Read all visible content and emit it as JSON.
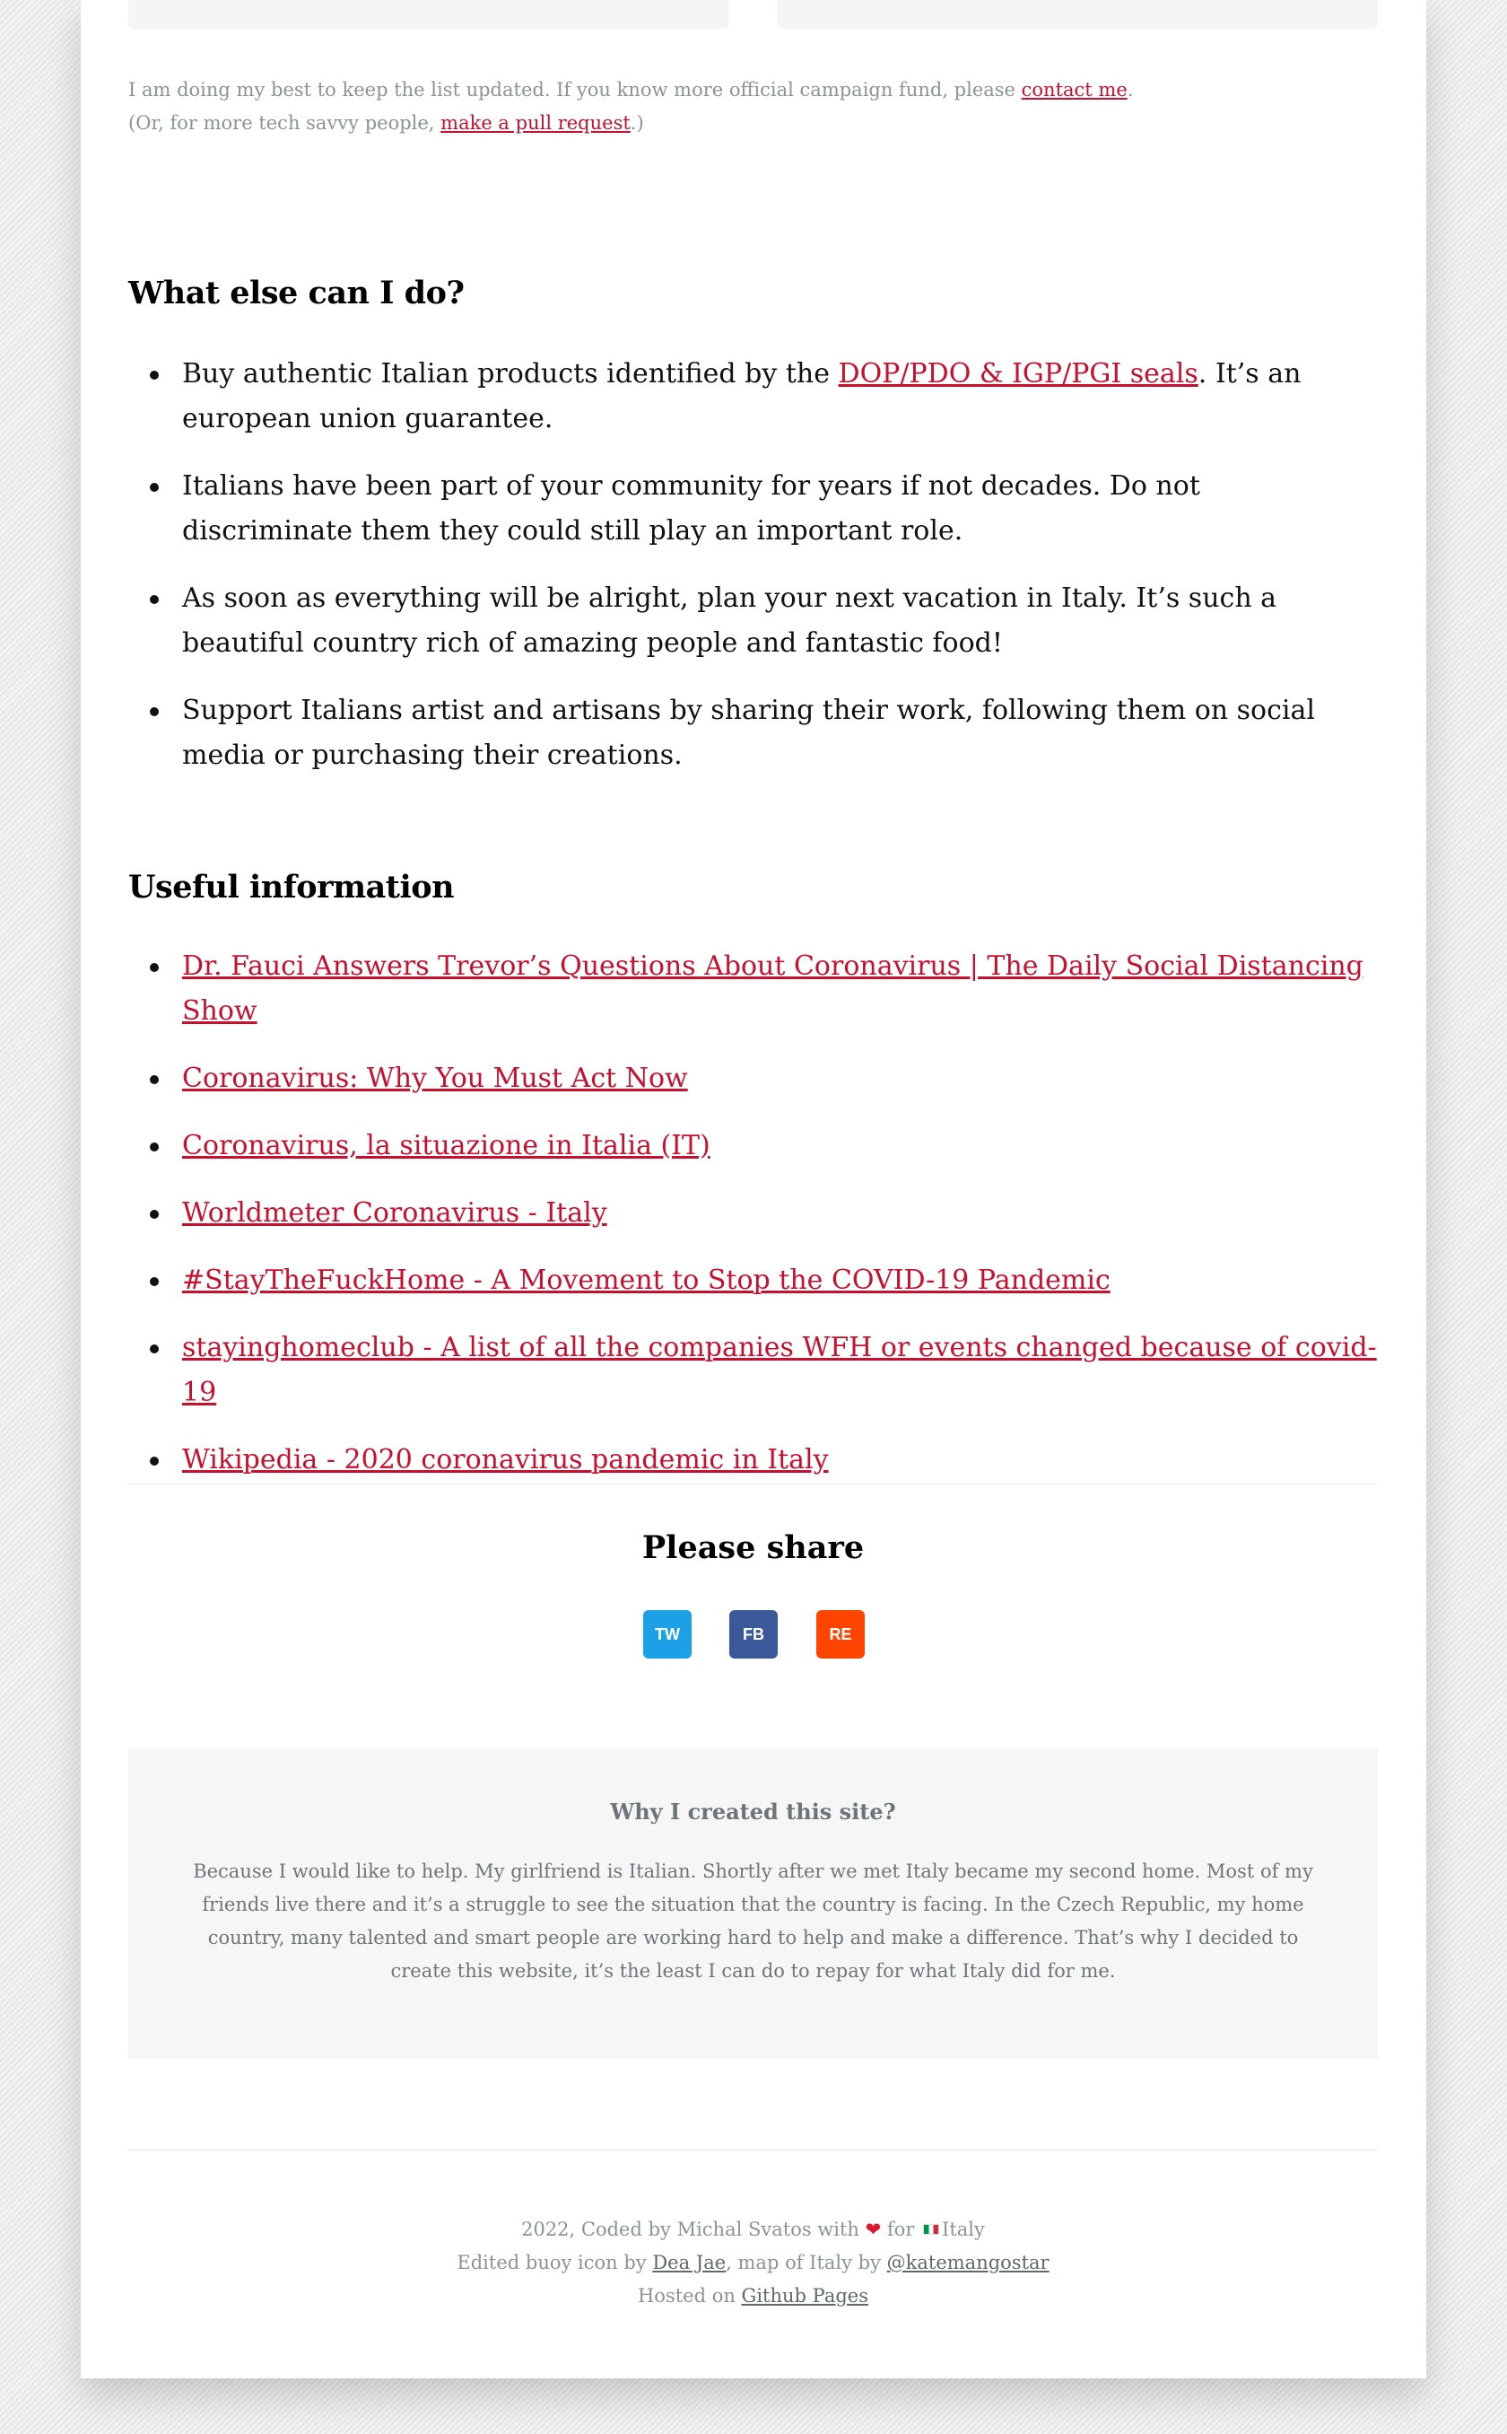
{
  "note": {
    "line1_prefix": "I am doing my best to keep the list updated. If you know more official campaign fund, please ",
    "line1_link": "contact me",
    "line1_suffix": ".",
    "line2_prefix": "(Or, for more tech savvy people, ",
    "line2_link": "make a pull request",
    "line2_suffix": ".)"
  },
  "what_else": {
    "title": "What else can I do?",
    "items": [
      {
        "prefix": "Buy authentic Italian products identified by the ",
        "link": "DOP/PDO & IGP/PGI seals",
        "suffix": ". It’s an european union guarantee."
      },
      {
        "text": "Italians have been part of your community for years if not decades. Do not discriminate them they could still play an important role."
      },
      {
        "text": "As soon as everything will be alright, plan your next vacation in Italy. It’s such a beautiful country rich of amazing people and fantastic food!"
      },
      {
        "text": "Support Italians artist and artisans by sharing their work, following them on social media or purchasing their creations."
      }
    ]
  },
  "useful": {
    "title": "Useful information",
    "links": [
      "Dr. Fauci Answers Trevor’s Questions About Coronavirus | The Daily Social Distancing Show",
      "Coronavirus: Why You Must Act Now",
      "Coronavirus, la situazione in Italia (IT)",
      "Worldmeter Coronavirus - Italy",
      "#StayTheFuckHome - A Movement to Stop the COVID-19 Pandemic",
      "stayinghomeclub - A list of all the companies WFH or events changed because of covid-19",
      "Wikipedia - 2020 coronavirus pandemic in Italy"
    ]
  },
  "share": {
    "title": "Please share",
    "buttons": [
      {
        "label": "TW",
        "color": "#1da1e6"
      },
      {
        "label": "FB",
        "color": "#3b5998"
      },
      {
        "label": "RE",
        "color": "#ff4500"
      }
    ]
  },
  "why": {
    "title": "Why I created this site?",
    "text": "Because I would like to help. My girlfriend is Italian. Shortly after we met Italy became my second home. Most of my friends live there and it’s a struggle to see the situation that the country is facing. In the Czech Republic, my home country, many talented and smart people are working hard to help and make a difference. That’s why I decided to create this website, it’s the least I can do to repay for what Italy did for me."
  },
  "footer": {
    "line1_prefix": "2022, Coded by Michal Svatos with ",
    "heart": "❤",
    "line1_mid": " for ",
    "line1_suffix": "Italy",
    "line2_prefix": "Edited buoy icon by ",
    "line2_link1": "Dea Jae",
    "line2_mid": ", map of Italy by ",
    "line2_link2": "@katemangostar",
    "line3_prefix": "Hosted on ",
    "line3_link": "Github Pages"
  },
  "colors": {
    "accent": "#c8102e",
    "muted_text": "#8a9396"
  }
}
